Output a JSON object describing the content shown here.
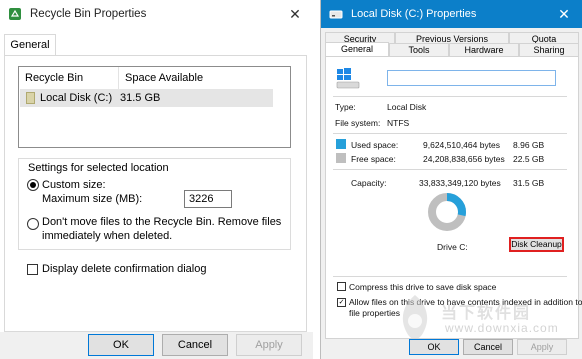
{
  "left_dialog": {
    "title": "Recycle Bin Properties",
    "close_glyph": "✕",
    "tab": "General",
    "list": {
      "col_location": "Recycle Bin Location",
      "col_space": "Space Available",
      "rows": [
        {
          "location": "Local Disk (C:)",
          "space": "31.5 GB"
        }
      ]
    },
    "settings_group_label": "Settings for selected location",
    "custom_size_label": "Custom size:",
    "max_size_label": "Maximum size (MB):",
    "max_size_value": "3226",
    "dont_move_line1": "Don't move files to the Recycle Bin. Remove files",
    "dont_move_line2": "immediately when deleted.",
    "display_confirm_label": "Display delete confirmation dialog",
    "buttons": {
      "ok": "OK",
      "cancel": "Cancel",
      "apply": "Apply"
    },
    "custom_size_selected": true,
    "display_confirm_checked": false
  },
  "right_dialog": {
    "title": "Local Disk (C:) Properties",
    "close_glyph": "✕",
    "tabs_row1": [
      "Security",
      "Previous Versions",
      "Quota"
    ],
    "tabs_row2": [
      "General",
      "Tools",
      "Hardware",
      "Sharing"
    ],
    "selected_tab": "General",
    "name_value": "",
    "type_label": "Type:",
    "type_value": "Local Disk",
    "fs_label": "File system:",
    "fs_value": "NTFS",
    "used_label": "Used space:",
    "used_bytes": "9,624,510,464 bytes",
    "used_gb": "8.96 GB",
    "free_label": "Free space:",
    "free_bytes": "24,208,838,656 bytes",
    "free_gb": "22.5 GB",
    "capacity_label": "Capacity:",
    "capacity_bytes": "33,833,349,120 bytes",
    "capacity_gb": "31.5 GB",
    "drive_label": "Drive C:",
    "cleanup_button": "Disk Cleanup",
    "used_fraction": 0.2845,
    "colors": {
      "used": "#26a0da",
      "free": "#bfbfbf",
      "titlebar": "#0c7fc9",
      "highlight": "#e02020"
    },
    "compress_label": "Compress this drive to save disk space",
    "compress_checked": false,
    "index_label_line1": "Allow files on this drive to have contents indexed in addition to",
    "index_label_line2": "file properties",
    "index_checked": true,
    "buttons": {
      "ok": "OK",
      "cancel": "Cancel",
      "apply": "Apply"
    }
  },
  "watermark": {
    "line1": "当下软件园",
    "line2": "www.downxia.com"
  }
}
